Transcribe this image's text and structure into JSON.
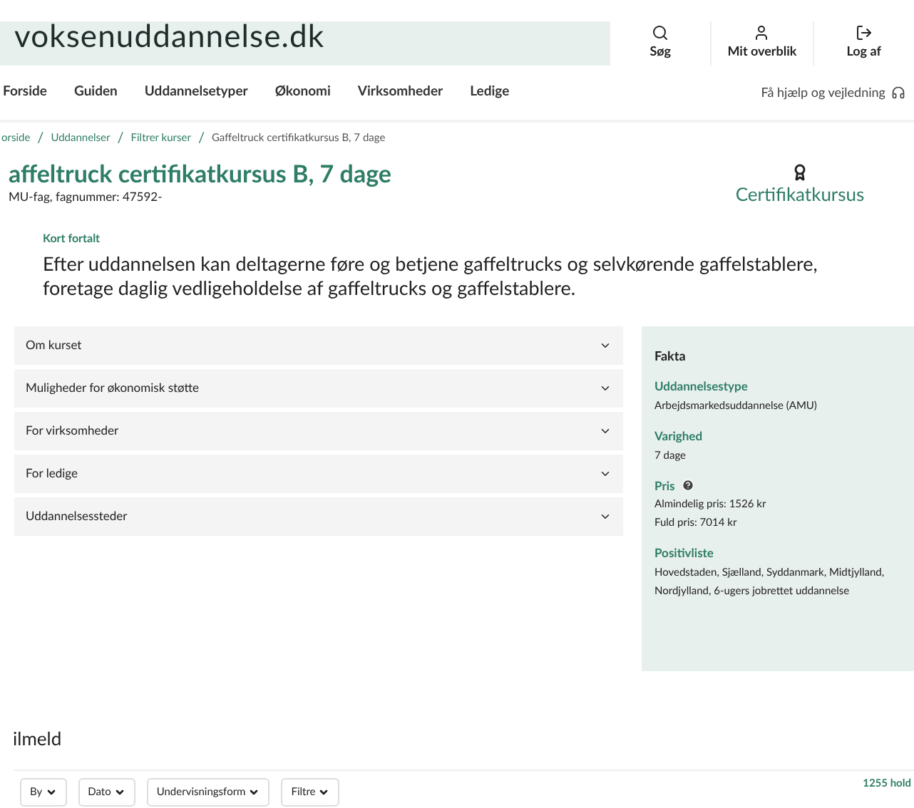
{
  "header": {
    "logo": "voksenuddannelse.dk",
    "actions": [
      {
        "label": "Søg",
        "kind": "search"
      },
      {
        "label": "Mit overblik",
        "kind": "user"
      },
      {
        "label": "Log af",
        "kind": "logout"
      }
    ]
  },
  "nav": {
    "items": [
      "Forside",
      "Guiden",
      "Uddannelsetyper",
      "Økonomi",
      "Virksomheder",
      "Ledige"
    ],
    "help": "Få hjælp og vejledning"
  },
  "breadcrumb": {
    "separator": "/",
    "links": [
      "orside",
      "Uddannelser",
      "Filtrer kurser"
    ],
    "current": "Gaffeltruck certifikatkursus B, 7 dage"
  },
  "course": {
    "title": "affeltruck certifikatkursus B, 7 dage",
    "subtitle": "MU-fag, fagnummer: 47592-",
    "badge": "Certifikatkursus"
  },
  "summary": {
    "heading": "Kort fortalt",
    "text": "Efter uddannelsen kan deltagerne føre og betjene gaffeltrucks og selvkørende gaffelstablere, foretage daglig vedligeholdelse af gaffeltrucks og gaffelstablere."
  },
  "accordion": [
    {
      "label": "Om kurset",
      "expanded": false
    },
    {
      "label": "Muligheder for økonomisk støtte",
      "expanded": false
    },
    {
      "label": "For virksomheder",
      "expanded": false
    },
    {
      "label": "For ledige",
      "expanded": false
    },
    {
      "label": "Uddannelsessteder",
      "expanded": false
    }
  ],
  "facts": {
    "title": "Fakta",
    "sections": [
      {
        "label": "Uddannelsestype",
        "lines": [
          "Arbejdsmarkedsuddannelse (AMU)"
        ],
        "help": false
      },
      {
        "label": "Varighed",
        "lines": [
          "7 dage"
        ],
        "help": false
      },
      {
        "label": "Pris",
        "lines": [
          "Almindelig pris: 1526 kr",
          "Fuld pris: 7014 kr"
        ],
        "help": true
      },
      {
        "label": "Positivliste",
        "lines": [
          "Hovedstaden, Sjælland, Syddanmark, Midtjylland, Nordjylland, 6-ugers jobrettet uddannelse"
        ],
        "help": false
      }
    ]
  },
  "signup": {
    "heading": "ilmeld",
    "filters": [
      "By",
      "Dato",
      "Undervisningsform",
      "Filtre"
    ],
    "count": "1255 hold"
  }
}
